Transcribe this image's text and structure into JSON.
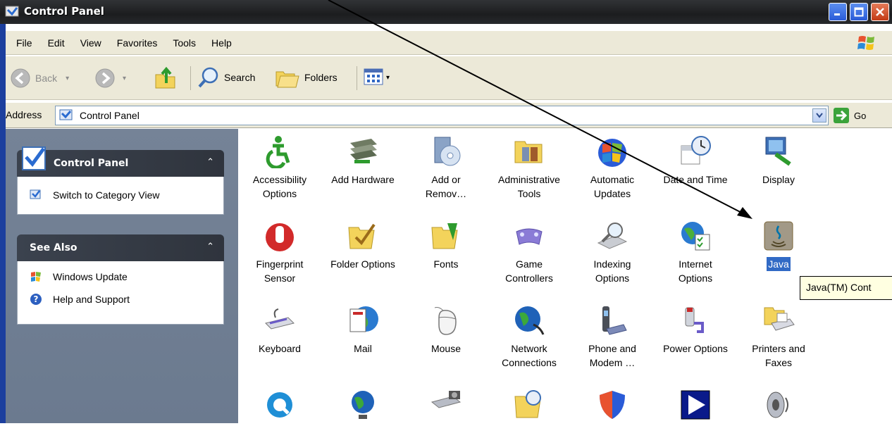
{
  "window": {
    "title": "Control Panel"
  },
  "menu": [
    "File",
    "Edit",
    "View",
    "Favorites",
    "Tools",
    "Help"
  ],
  "toolbar": {
    "back_label": "Back",
    "search_label": "Search",
    "folders_label": "Folders"
  },
  "address": {
    "label": "Address",
    "value": "Control Panel",
    "go_label": "Go"
  },
  "taskpane": {
    "control_panel": {
      "title": "Control Panel",
      "link": "Switch to Category View"
    },
    "see_also": {
      "title": "See Also",
      "links": [
        "Windows Update",
        "Help and Support"
      ]
    }
  },
  "items": [
    {
      "l1": "Accessibility",
      "l2": "Options",
      "icon": "accessibility-icon"
    },
    {
      "l1": "Add Hardware",
      "l2": "",
      "icon": "add-hardware-icon"
    },
    {
      "l1": "Add or",
      "l2": "Remov…",
      "icon": "add-remove-programs-icon"
    },
    {
      "l1": "Administrative",
      "l2": "Tools",
      "icon": "administrative-tools-icon"
    },
    {
      "l1": "Automatic",
      "l2": "Updates",
      "icon": "automatic-updates-icon"
    },
    {
      "l1": "Date and Time",
      "l2": "",
      "icon": "date-time-icon"
    },
    {
      "l1": "Display",
      "l2": "",
      "icon": "display-icon"
    },
    {
      "l1": "Fingerprint",
      "l2": "Sensor",
      "icon": "fingerprint-icon"
    },
    {
      "l1": "Folder Options",
      "l2": "",
      "icon": "folder-options-icon"
    },
    {
      "l1": "Fonts",
      "l2": "",
      "icon": "fonts-folder-icon"
    },
    {
      "l1": "Game",
      "l2": "Controllers",
      "icon": "game-controller-icon"
    },
    {
      "l1": "Indexing",
      "l2": "Options",
      "icon": "indexing-icon"
    },
    {
      "l1": "Internet",
      "l2": "Options",
      "icon": "internet-options-icon"
    },
    {
      "l1": "Java",
      "l2": "",
      "icon": "java-icon"
    },
    {
      "l1": "Keyboard",
      "l2": "",
      "icon": "keyboard-icon"
    },
    {
      "l1": "Mail",
      "l2": "",
      "icon": "mail-icon"
    },
    {
      "l1": "Mouse",
      "l2": "",
      "icon": "mouse-icon"
    },
    {
      "l1": "Network",
      "l2": "Connections",
      "icon": "network-icon"
    },
    {
      "l1": "Phone and",
      "l2": "Modem …",
      "icon": "phone-modem-icon"
    },
    {
      "l1": "Power Options",
      "l2": "",
      "icon": "power-options-icon"
    },
    {
      "l1": "Printers and",
      "l2": "Faxes",
      "icon": "printer-icon"
    }
  ],
  "tooltip": "Java(TM) Cont",
  "colors": {
    "titlebar": "#1c1d1f",
    "pane": "#6b7a8f",
    "selection": "#316ac5",
    "tooltip_bg": "#ffffe1"
  }
}
